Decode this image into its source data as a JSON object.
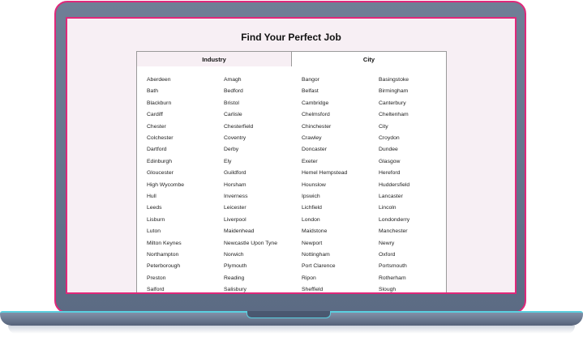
{
  "page": {
    "title": "Find Your Perfect Job"
  },
  "tabs": {
    "industry": "Industry",
    "city": "City"
  },
  "cities": [
    [
      "Aberdeen",
      "Amagh",
      "Bangor",
      "Basingstoke"
    ],
    [
      "Bath",
      "Bedford",
      "Belfast",
      "Birmingham"
    ],
    [
      "Blackburn",
      "Bristol",
      "Cambridge",
      "Canterbury"
    ],
    [
      "Cardiff",
      "Carlisle",
      "Chelmsford",
      "Cheltenham"
    ],
    [
      "Chester",
      "Chesterfield",
      "Chinchester",
      "City"
    ],
    [
      "Colchester",
      "Coventry",
      "Crawley",
      "Croydon"
    ],
    [
      "Dartford",
      "Derby",
      "Doncaster",
      "Dundee"
    ],
    [
      "Edinburgh",
      "Ely",
      "Exeter",
      "Glasgow"
    ],
    [
      "Gloucester",
      "Guildford",
      "Hemel Hempstead",
      "Hereford"
    ],
    [
      "High Wycombe",
      "Horsham",
      "Hounslow",
      "Huddersfield"
    ],
    [
      "Hull",
      "Inverness",
      "Ipswich",
      "Lancaster"
    ],
    [
      "Leeds",
      "Leicester",
      "Lichfield",
      "Lincoln"
    ],
    [
      "Lisburn",
      "Liverpool",
      "London",
      "Londonderry"
    ],
    [
      "Luton",
      "Maidenhead",
      "Maidstone",
      "Manchester"
    ],
    [
      "Milton Keynes",
      "Newcastle Upon Tyne",
      "Newport",
      "Newry"
    ],
    [
      "Northampton",
      "Norwich",
      "Nottingham",
      "Oxford"
    ],
    [
      "Peterborough",
      "Plymouth",
      "Port Clarence",
      "Portsmouth"
    ],
    [
      "Preston",
      "Reading",
      "Ripon",
      "Rotherham"
    ],
    [
      "Salford",
      "Salisbury",
      "Sheffield",
      "Slough"
    ]
  ],
  "colors": {
    "frame_accent": "#e0287a",
    "base_accent": "#5ad0e0",
    "screen_bg": "#f7eff4"
  }
}
